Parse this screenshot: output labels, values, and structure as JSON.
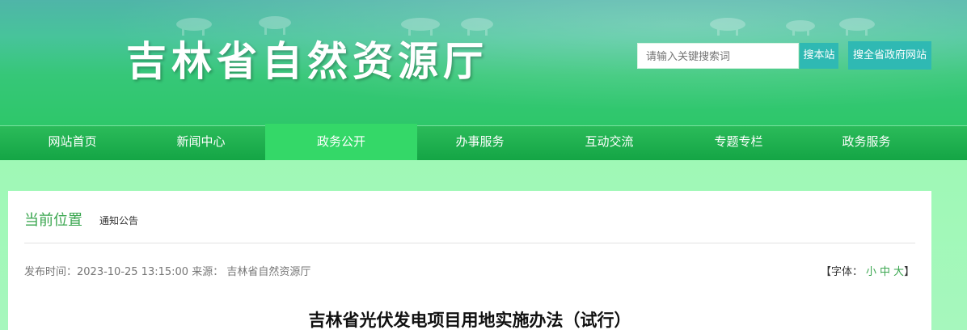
{
  "header": {
    "site_title": "吉林省自然资源厅",
    "search_placeholder": "请输入关键搜索词",
    "search_site_button": "搜本站",
    "search_gov_button": "搜全省政府网站"
  },
  "nav": {
    "items": [
      {
        "label": "网站首页"
      },
      {
        "label": "新闻中心"
      },
      {
        "label": "政务公开"
      },
      {
        "label": "办事服务"
      },
      {
        "label": "互动交流"
      },
      {
        "label": "专题专栏"
      },
      {
        "label": "政务服务"
      }
    ],
    "active_label": "政务公开"
  },
  "breadcrumb": {
    "label": "当前位置",
    "value": "通知公告"
  },
  "article": {
    "meta_text": "发布时间：2023-10-25 13:15:00 来源： 吉林省自然资源厅",
    "font_prefix": "【字体：",
    "font_small": "小",
    "font_medium": "中",
    "font_large": "大",
    "font_suffix": "】",
    "title": "吉林省光伏发电项目用地实施办法（试行）"
  },
  "colors": {
    "accent": "#3aa64f",
    "nav_bg": "#14a545",
    "nav_active": "#34d868",
    "search_button": "#2fb9b3",
    "band": "#9ef7b6"
  }
}
